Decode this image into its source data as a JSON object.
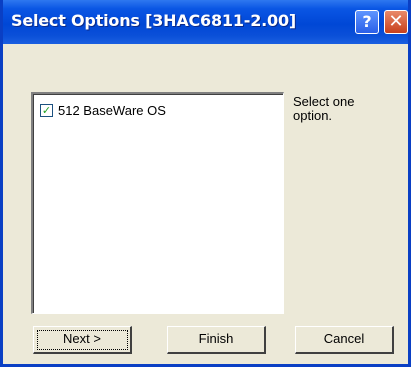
{
  "window": {
    "title": "Select Options [3HAC6811-2.00]",
    "help_glyph": "?",
    "close_glyph": "✕"
  },
  "options_list": {
    "items": [
      {
        "label": "512 BaseWare OS",
        "checked": true
      }
    ]
  },
  "info": {
    "text": "Select one option."
  },
  "buttons": {
    "next": "Next >",
    "finish": "Finish",
    "cancel": "Cancel"
  },
  "colors": {
    "titlebar": "#0047d6",
    "face": "#ece9d8",
    "checkmark": "#21a121"
  },
  "icons": {
    "help": "help-icon",
    "close": "close-icon"
  }
}
